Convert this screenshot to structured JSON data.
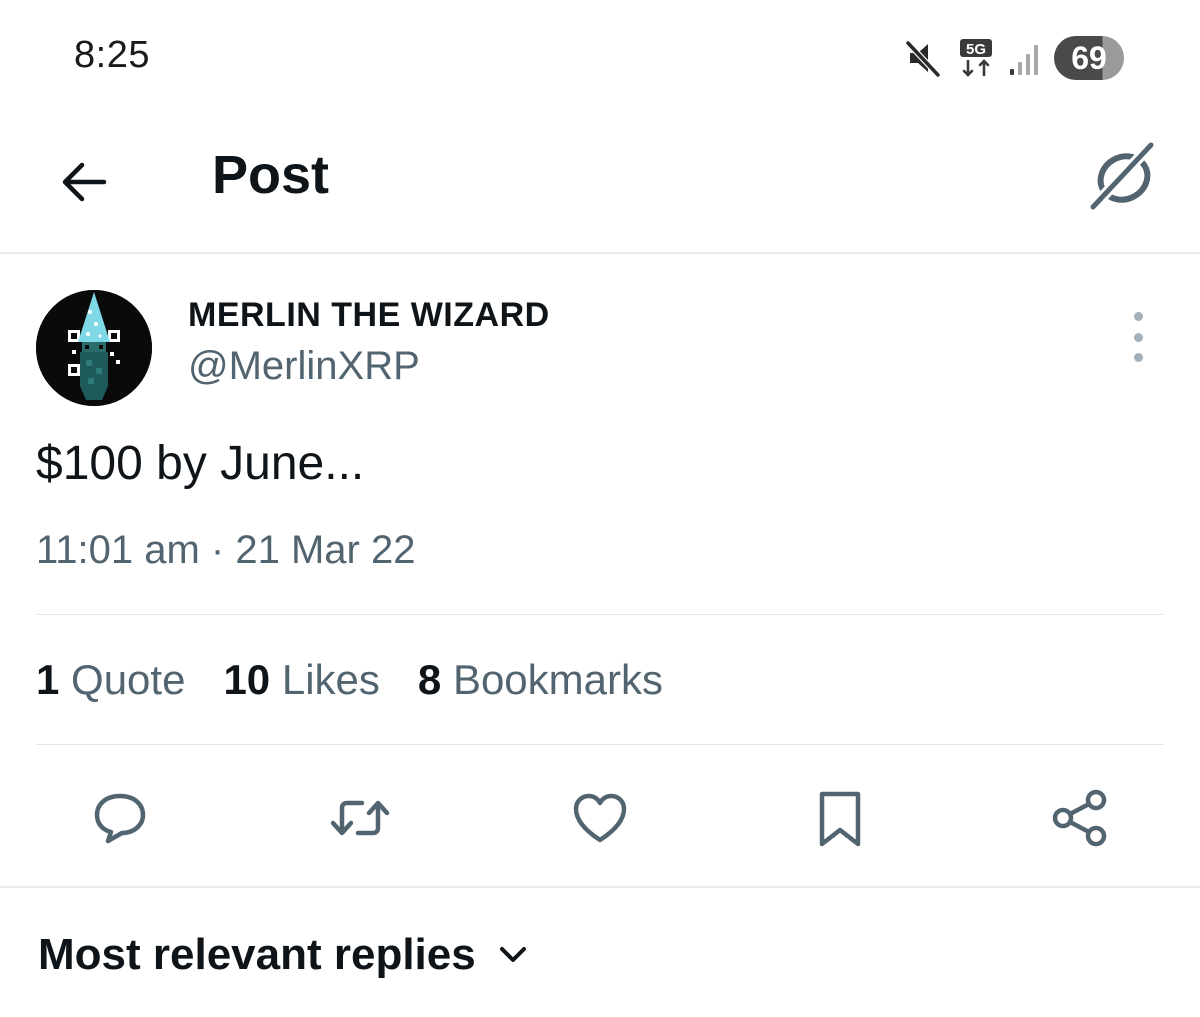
{
  "status_bar": {
    "time": "8:25",
    "network": "5G",
    "battery": "69",
    "icons": [
      "mute-icon",
      "5g-data-icon",
      "signal-icon",
      "battery-icon"
    ]
  },
  "header": {
    "title": "Post",
    "back_icon": "arrow-left-icon",
    "grok_icon": "grok-icon"
  },
  "post": {
    "author": {
      "display_name": "MERLIN THE WIZARD",
      "handle": "@MerlinXRP"
    },
    "text": "$100 by June...",
    "timestamp": "11:01 am · 21 Mar 22",
    "stats": [
      {
        "count": "1",
        "label": "Quote"
      },
      {
        "count": "10",
        "label": "Likes"
      },
      {
        "count": "8",
        "label": "Bookmarks"
      }
    ],
    "actions": [
      "reply-icon",
      "repost-icon",
      "like-icon",
      "bookmark-icon",
      "share-icon"
    ]
  },
  "replies": {
    "sort_label": "Most relevant replies"
  },
  "colors": {
    "text_primary": "#0f1419",
    "text_secondary": "#536471",
    "icon": "#536471",
    "divider": "#e7ebee",
    "avatar_hat": "#7fd8e6"
  }
}
